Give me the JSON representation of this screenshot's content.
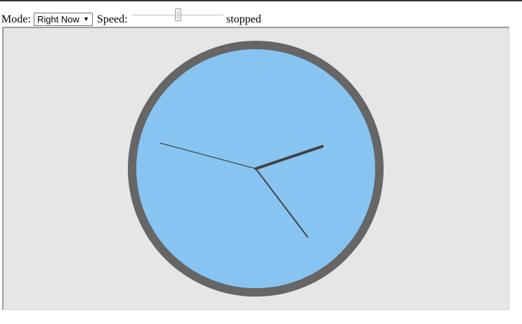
{
  "toolbar": {
    "mode_label": "Mode:",
    "mode_value": "Right Now",
    "speed_label": "Speed:",
    "speed_level": 0.5,
    "status": "stopped"
  },
  "clock": {
    "time": {
      "hours": 2,
      "minutes": 23,
      "seconds": 47.5
    },
    "face_color": "#87c4f2",
    "rim_color": "#666666",
    "hand_color": "#444444",
    "background_color": "#e6e6e6"
  }
}
